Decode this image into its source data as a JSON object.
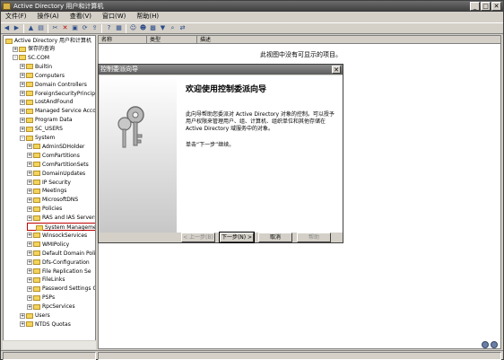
{
  "window": {
    "title": "Active Directory 用户和计算机",
    "controls": [
      "_",
      "□",
      "✕"
    ]
  },
  "menu": [
    "文件(F)",
    "操作(A)",
    "查看(V)",
    "窗口(W)",
    "帮助(H)"
  ],
  "toolbar_icons": [
    "back-icon",
    "forward-icon",
    "up-icon",
    "show-hide-tree-icon",
    "cut-icon",
    "delete-icon",
    "properties-icon",
    "refresh-icon",
    "export-icon",
    "help-icon",
    "view-icon",
    "user-icon",
    "group-icon",
    "ou-icon",
    "filter-icon",
    "find-icon",
    "move-icon"
  ],
  "tree": {
    "root": "Active Directory 用户和计算机",
    "items": [
      {
        "label": "保存的查询",
        "level": 1,
        "exp": "+"
      },
      {
        "label": "SC.COM",
        "level": 1,
        "exp": "-"
      },
      {
        "label": "Builtin",
        "level": 2,
        "exp": "+"
      },
      {
        "label": "Computers",
        "level": 2,
        "exp": "+"
      },
      {
        "label": "Domain Controllers",
        "level": 2,
        "exp": "+"
      },
      {
        "label": "ForeignSecurityPrincip",
        "level": 2,
        "exp": "+"
      },
      {
        "label": "LostAndFound",
        "level": 2,
        "exp": "+"
      },
      {
        "label": "Managed Service Accour",
        "level": 2,
        "exp": "+"
      },
      {
        "label": "Program Data",
        "level": 2,
        "exp": "+"
      },
      {
        "label": "SC_USERS",
        "level": 2,
        "exp": "+"
      },
      {
        "label": "System",
        "level": 2,
        "exp": "-"
      },
      {
        "label": "AdminSDHolder",
        "level": 3,
        "exp": "+"
      },
      {
        "label": "ComPartitions",
        "level": 3,
        "exp": "+"
      },
      {
        "label": "ComPartitionSets",
        "level": 3,
        "exp": "+"
      },
      {
        "label": "DomainUpdates",
        "level": 3,
        "exp": "+"
      },
      {
        "label": "IP Security",
        "level": 3,
        "exp": "+"
      },
      {
        "label": "Meetings",
        "level": 3,
        "exp": "+"
      },
      {
        "label": "MicrosoftDNS",
        "level": 3,
        "exp": "+"
      },
      {
        "label": "Policies",
        "level": 3,
        "exp": "+"
      },
      {
        "label": "RAS and IAS Servers",
        "level": 3,
        "exp": "+"
      },
      {
        "label": "System Management",
        "level": 3,
        "exp": "",
        "highlight": true
      },
      {
        "label": "WinsockServices",
        "level": 3,
        "exp": "+"
      },
      {
        "label": "WMIPolicy",
        "level": 3,
        "exp": "+"
      },
      {
        "label": "Default Domain Poli",
        "level": 3,
        "exp": "+"
      },
      {
        "label": "Dfs-Configuration",
        "level": 3,
        "exp": "+"
      },
      {
        "label": "File Replication Se",
        "level": 3,
        "exp": "+"
      },
      {
        "label": "FileLinks",
        "level": 3,
        "exp": "+"
      },
      {
        "label": "Password Settings C",
        "level": 3,
        "exp": "+"
      },
      {
        "label": "PSPs",
        "level": 3,
        "exp": "+"
      },
      {
        "label": "RpcServices",
        "level": 3,
        "exp": "+"
      },
      {
        "label": "Users",
        "level": 2,
        "exp": "+"
      },
      {
        "label": "NTDS Quotas",
        "level": 2,
        "exp": "+"
      }
    ]
  },
  "list": {
    "columns": [
      "名称",
      "类型",
      "描述"
    ],
    "empty_message": "此视图中没有可显示的项目。"
  },
  "dialog": {
    "title": "控制委派向导",
    "heading": "欢迎使用控制委派向导",
    "paragraph": "此向导帮助您委派对 Active Directory 对象的控制。可以授予用户权限来管理用户、组、计算机、组织单位和其他存储在 Active Directory 域服务中的对象。",
    "instruction": "单击“下一步”继续。",
    "buttons": {
      "back": "< 上一步(B)",
      "next": "下一步(N) >",
      "cancel": "取消",
      "help": "帮助"
    }
  }
}
